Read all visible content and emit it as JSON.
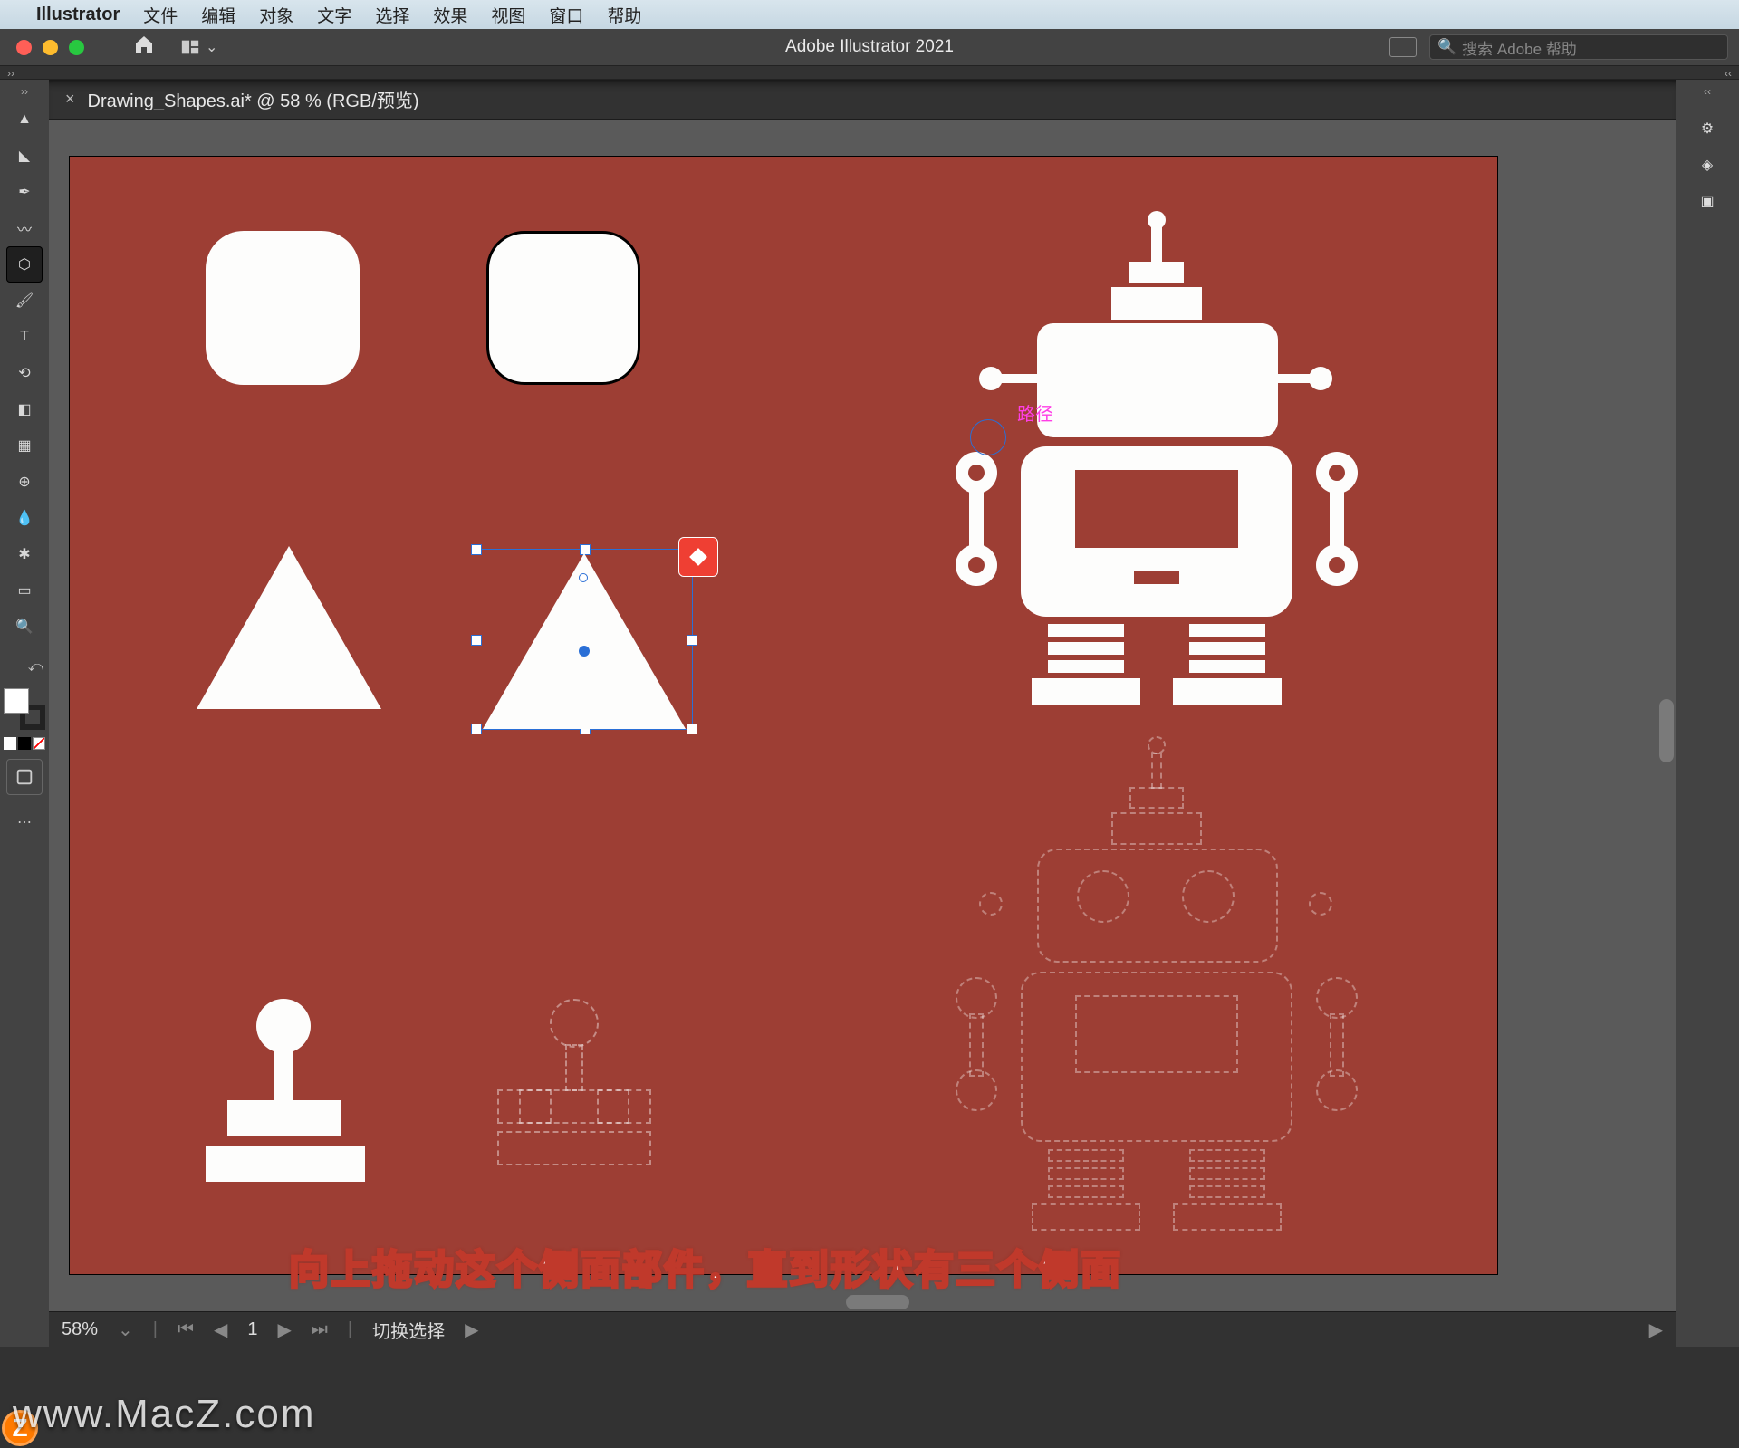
{
  "menubar": {
    "apple_glyph": "",
    "app_name": "Illustrator",
    "items": [
      "文件",
      "编辑",
      "对象",
      "文字",
      "选择",
      "效果",
      "视图",
      "窗口",
      "帮助"
    ]
  },
  "titlebar": {
    "app_title": "Adobe Illustrator 2021",
    "search_placeholder": "搜索 Adobe 帮助"
  },
  "document_tab": {
    "close_glyph": "×",
    "label": "Drawing_Shapes.ai* @ 58 % (RGB/预览)"
  },
  "tools": [
    {
      "name": "selection-tool",
      "glyph": "▲"
    },
    {
      "name": "direct-selection-tool",
      "glyph": "◣"
    },
    {
      "name": "pen-tool",
      "glyph": "✒"
    },
    {
      "name": "curvature-tool",
      "glyph": "〰"
    },
    {
      "name": "polygon-tool",
      "glyph": "⬡",
      "active": true
    },
    {
      "name": "paintbrush-tool",
      "glyph": "🖌"
    },
    {
      "name": "type-tool",
      "glyph": "T"
    },
    {
      "name": "rotate-tool",
      "glyph": "⟲"
    },
    {
      "name": "eraser-tool",
      "glyph": "◧"
    },
    {
      "name": "gradient-tool",
      "glyph": "▦"
    },
    {
      "name": "shape-builder-tool",
      "glyph": "⊕"
    },
    {
      "name": "eyedropper-tool",
      "glyph": "💧"
    },
    {
      "name": "symbol-sprayer-tool",
      "glyph": "✱"
    },
    {
      "name": "artboard-tool",
      "glyph": "▭"
    },
    {
      "name": "zoom-tool",
      "glyph": "🔍"
    }
  ],
  "panels": [
    {
      "name": "properties-panel",
      "glyph": "⚙"
    },
    {
      "name": "layers-panel",
      "glyph": "◈"
    },
    {
      "name": "libraries-panel",
      "glyph": "▣"
    }
  ],
  "canvas": {
    "path_tooltip": "路径",
    "live_corner_widget": "polygon-side-widget"
  },
  "statusbar": {
    "zoom": "58%",
    "dropdown_glyph": "⌄",
    "nav_first": "⏮",
    "nav_prev": "◀",
    "artboard_num": "1",
    "nav_next": "▶",
    "nav_last": "⏭",
    "mode_label": "切换选择",
    "mode_arrow": "▶"
  },
  "caption_text": "向上拖动这个侧面部件，直到形状有三个侧面",
  "watermark_text": "www.MacZ.com",
  "watermark_badge": "Z"
}
